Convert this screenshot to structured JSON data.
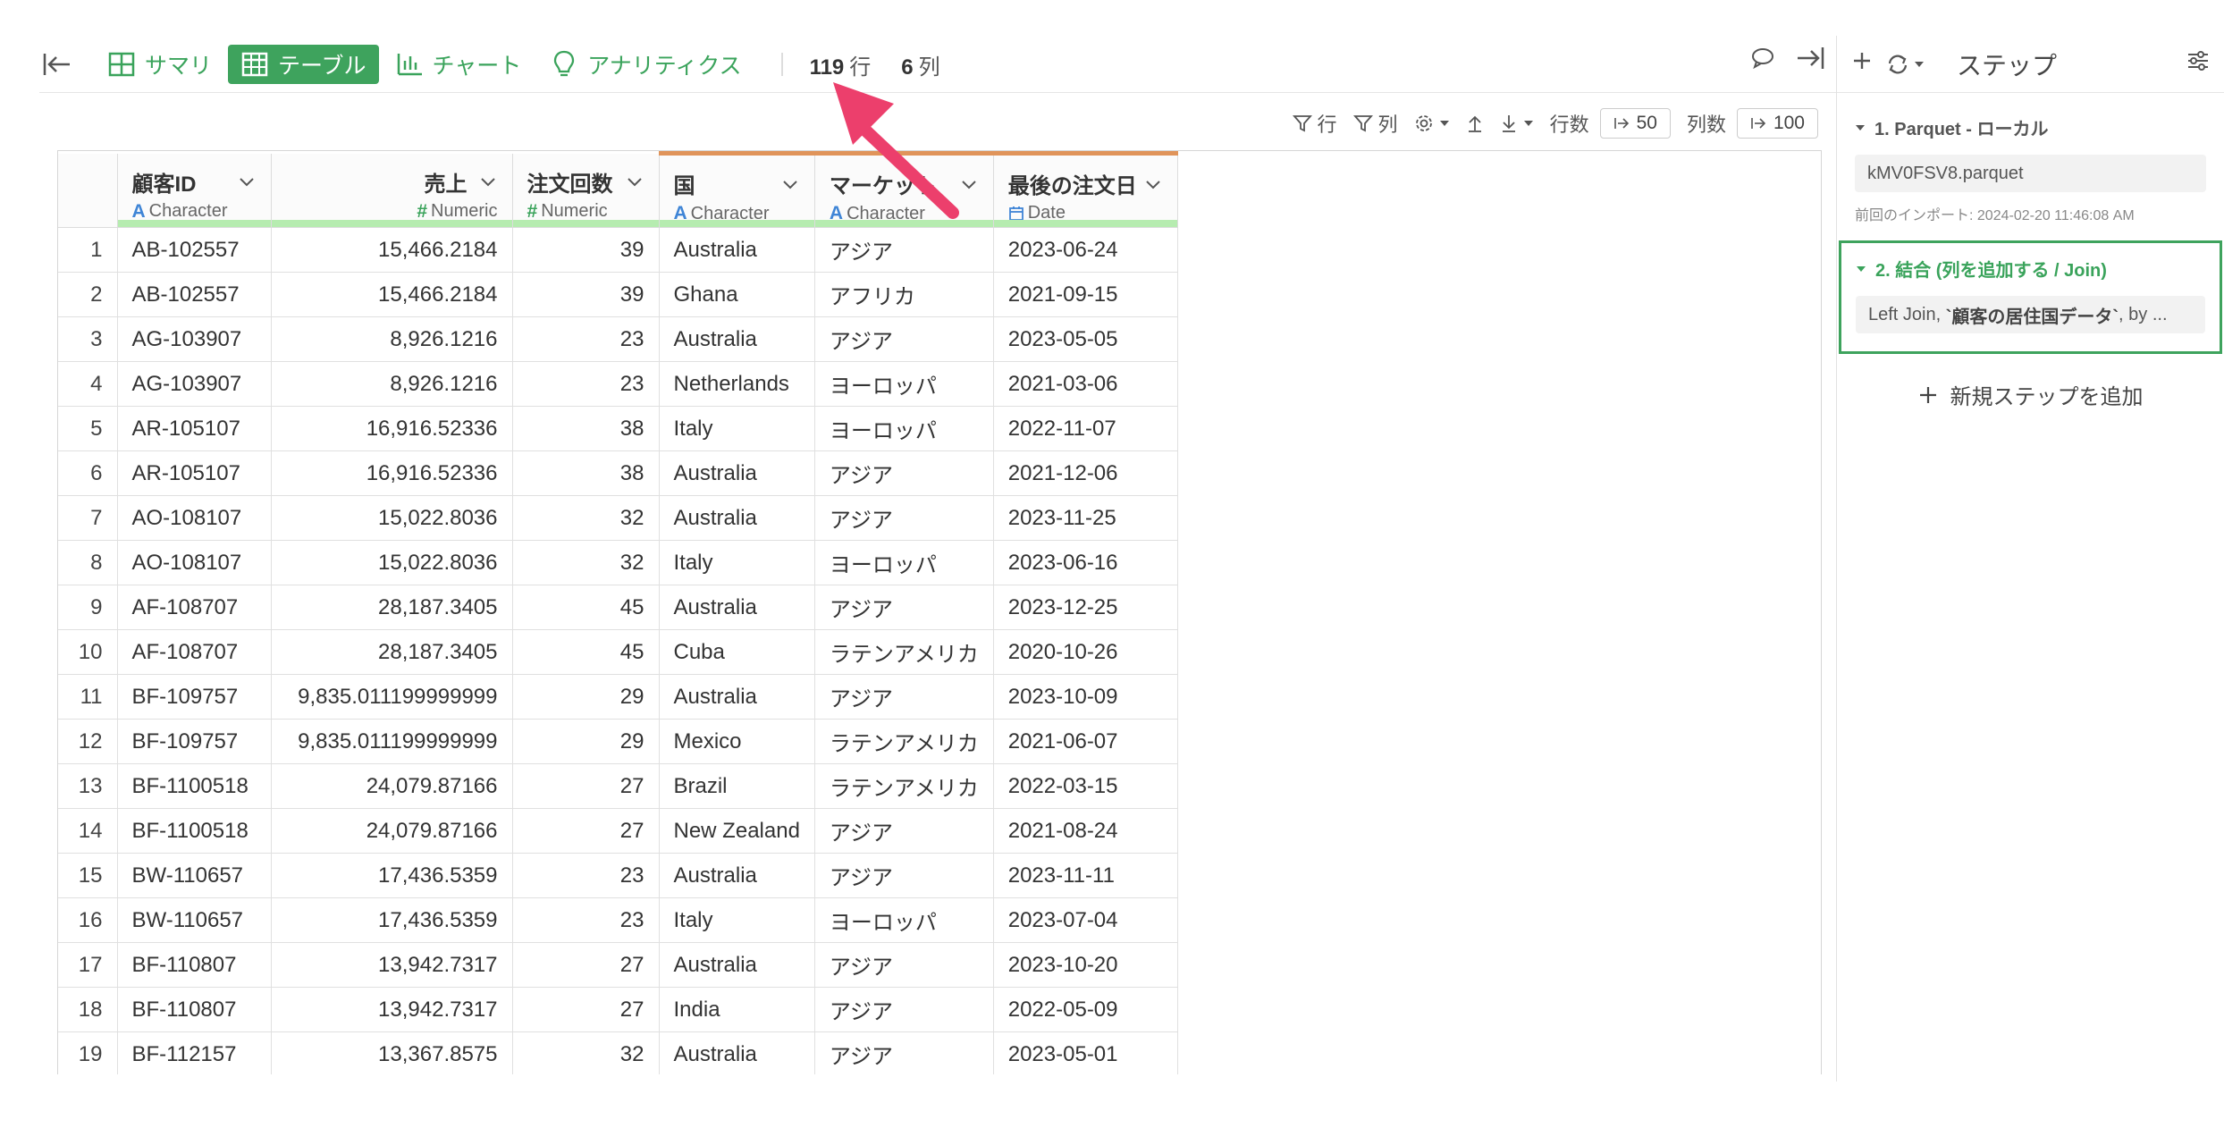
{
  "tabs": [
    {
      "label": "サマリ",
      "active": false,
      "icon": "summary-grid-icon"
    },
    {
      "label": "テーブル",
      "active": true,
      "icon": "table-icon"
    },
    {
      "label": "チャート",
      "active": false,
      "icon": "bar-chart-icon"
    },
    {
      "label": "アナリティクス",
      "active": false,
      "icon": "lightbulb-icon"
    }
  ],
  "counts": {
    "rows": "119",
    "rows_unit": "行",
    "cols": "6",
    "cols_unit": "列"
  },
  "toolbar2": {
    "row_filter": "行",
    "col_filter": "列",
    "rows_label": "行数",
    "rows_value": "50",
    "cols_label": "列数",
    "cols_value": "100"
  },
  "columns": [
    {
      "name": "顧客ID",
      "type": "Character",
      "type_icon": "A",
      "align": "left"
    },
    {
      "name": "売上",
      "type": "Numeric",
      "type_icon": "#",
      "align": "right"
    },
    {
      "name": "注文回数",
      "type": "Numeric",
      "type_icon": "#",
      "align": "left"
    },
    {
      "name": "国",
      "type": "Character",
      "type_icon": "A",
      "align": "left"
    },
    {
      "name": "マーケット",
      "type": "Character",
      "type_icon": "A",
      "align": "left"
    },
    {
      "name": "最後の注文日",
      "type": "Date",
      "type_icon": "calendar",
      "align": "left"
    }
  ],
  "rows": [
    [
      "1",
      "AB-102557",
      "15,466.2184",
      "39",
      "Australia",
      "アジア",
      "2023-06-24"
    ],
    [
      "2",
      "AB-102557",
      "15,466.2184",
      "39",
      "Ghana",
      "アフリカ",
      "2021-09-15"
    ],
    [
      "3",
      "AG-103907",
      "8,926.1216",
      "23",
      "Australia",
      "アジア",
      "2023-05-05"
    ],
    [
      "4",
      "AG-103907",
      "8,926.1216",
      "23",
      "Netherlands",
      "ヨーロッパ",
      "2021-03-06"
    ],
    [
      "5",
      "AR-105107",
      "16,916.52336",
      "38",
      "Italy",
      "ヨーロッパ",
      "2022-11-07"
    ],
    [
      "6",
      "AR-105107",
      "16,916.52336",
      "38",
      "Australia",
      "アジア",
      "2021-12-06"
    ],
    [
      "7",
      "AO-108107",
      "15,022.8036",
      "32",
      "Australia",
      "アジア",
      "2023-11-25"
    ],
    [
      "8",
      "AO-108107",
      "15,022.8036",
      "32",
      "Italy",
      "ヨーロッパ",
      "2023-06-16"
    ],
    [
      "9",
      "AF-108707",
      "28,187.3405",
      "45",
      "Australia",
      "アジア",
      "2023-12-25"
    ],
    [
      "10",
      "AF-108707",
      "28,187.3405",
      "45",
      "Cuba",
      "ラテンアメリカ",
      "2020-10-26"
    ],
    [
      "11",
      "BF-109757",
      "9,835.011199999999",
      "29",
      "Australia",
      "アジア",
      "2023-10-09"
    ],
    [
      "12",
      "BF-109757",
      "9,835.011199999999",
      "29",
      "Mexico",
      "ラテンアメリカ",
      "2021-06-07"
    ],
    [
      "13",
      "BF-1100518",
      "24,079.87166",
      "27",
      "Brazil",
      "ラテンアメリカ",
      "2022-03-15"
    ],
    [
      "14",
      "BF-1100518",
      "24,079.87166",
      "27",
      "New Zealand",
      "アジア",
      "2021-08-24"
    ],
    [
      "15",
      "BW-110657",
      "17,436.5359",
      "23",
      "Australia",
      "アジア",
      "2023-11-11"
    ],
    [
      "16",
      "BW-110657",
      "17,436.5359",
      "23",
      "Italy",
      "ヨーロッパ",
      "2023-07-04"
    ],
    [
      "17",
      "BF-110807",
      "13,942.7317",
      "27",
      "Australia",
      "アジア",
      "2023-10-20"
    ],
    [
      "18",
      "BF-110807",
      "13,942.7317",
      "27",
      "India",
      "アジア",
      "2022-05-09"
    ],
    [
      "19",
      "BF-112157",
      "13,367.8575",
      "32",
      "Australia",
      "アジア",
      "2023-05-01"
    ]
  ],
  "panel": {
    "title": "ステップ",
    "steps": [
      {
        "title": "1. Parquet - ローカル",
        "box": "kMV0FSV8.parquet",
        "meta": "前回のインポート: 2024-02-20 11:46:08 AM",
        "active": false
      },
      {
        "title": "2. 結合 (列を追加する / Join)",
        "box_prefix": "Left Join, ",
        "box_bold": "`顧客の居住国データ`",
        "box_suffix": ", by ...",
        "active": true
      }
    ],
    "add_step": "新規ステップを追加"
  },
  "colors": {
    "accent": "#3ea35d",
    "character_type": "#3f85d6",
    "numeric_type": "#3aa35b",
    "quality_bar": "#b6ecb0",
    "highlight_header": "#e0945a",
    "annotation_arrow": "#ec3f6c"
  }
}
